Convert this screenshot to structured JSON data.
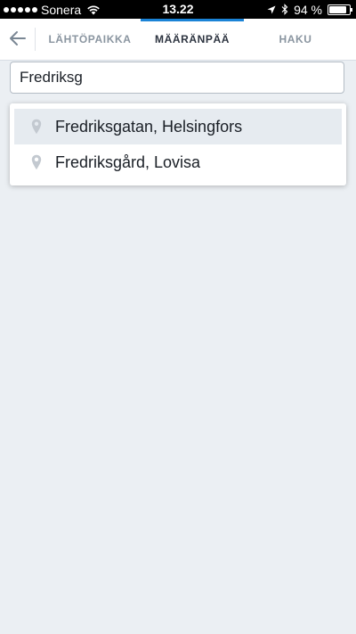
{
  "status_bar": {
    "carrier": "Sonera",
    "time": "13.22",
    "battery_text": "94 %",
    "battery_level": 0.94
  },
  "header": {
    "back_icon": "arrow-left-icon",
    "tabs": [
      {
        "label": "LÄHTÖPAIKKA",
        "active": false
      },
      {
        "label": "MÄÄRÄNPÄÄ",
        "active": true
      },
      {
        "label": "HAKU",
        "active": false
      }
    ]
  },
  "search": {
    "value": "Fredriksg"
  },
  "suggestions": [
    {
      "label": "Fredriksgatan, Helsingfors",
      "icon": "location-pin-icon",
      "highlighted": true
    },
    {
      "label": "Fredriksgård, Lovisa",
      "icon": "location-pin-icon",
      "highlighted": false
    }
  ],
  "colors": {
    "accent": "#1b83d6",
    "background": "#ebeff3",
    "tab_inactive": "#8a95a0",
    "tab_active": "#2d3440"
  }
}
